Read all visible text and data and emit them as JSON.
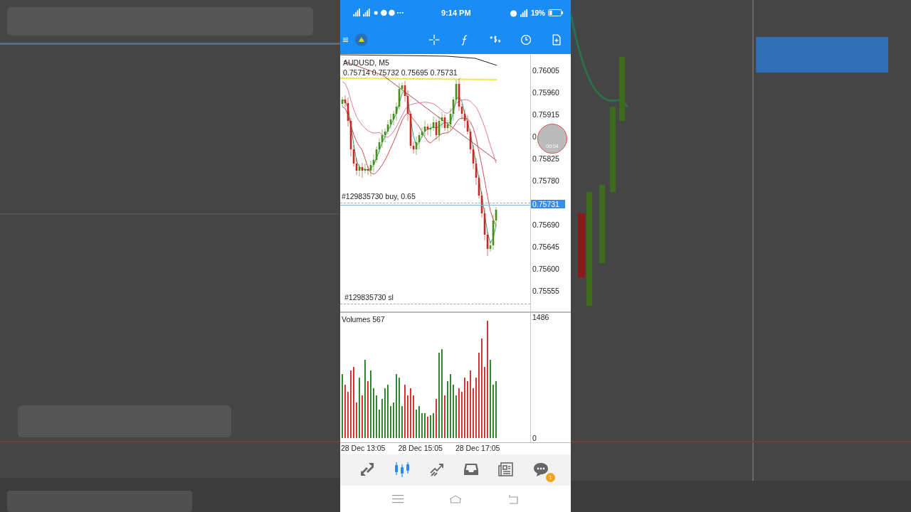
{
  "status_bar": {
    "time": "9:14 PM",
    "battery": "19%"
  },
  "chart": {
    "symbol": "AUDUSD, M5",
    "ohlc": "0.75714 0.75732 0.75695 0.75731",
    "price_labels": [
      "0.76005",
      "0.75960",
      "0.75915",
      "0",
      "0.75825",
      "0.75780",
      "0.75690",
      "0.75645",
      "0.75600",
      "0.75555"
    ],
    "current_price": "0.75731",
    "order_label": "#129835730 buy, 0.65",
    "sl_label": "#129835730 sl"
  },
  "recorder_bubble": {
    "time": "00:04"
  },
  "volumes": {
    "label": "Volumes 567",
    "max": "1486",
    "min": "0"
  },
  "time_labels": [
    "28 Dec 13:05",
    "28 Dec 15:05",
    "28 Dec 17:05"
  ],
  "bottom_nav": [
    {
      "kind": "quotes",
      "selected": false
    },
    {
      "kind": "chart",
      "selected": true
    },
    {
      "kind": "trade",
      "selected": false
    },
    {
      "kind": "history",
      "selected": false
    },
    {
      "kind": "news",
      "selected": false
    },
    {
      "kind": "messages",
      "selected": false,
      "badge": "1"
    }
  ]
}
